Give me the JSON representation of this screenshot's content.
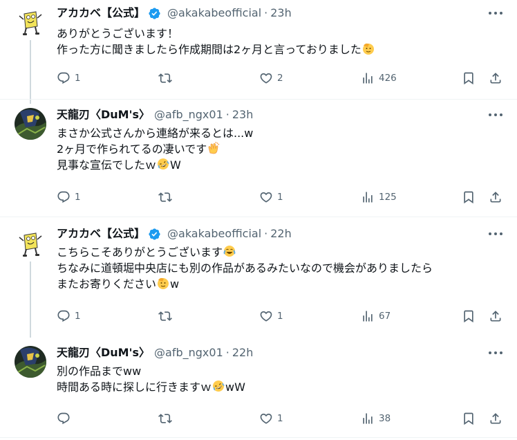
{
  "tweets": [
    {
      "name": "アカカベ【公式】",
      "verified": true,
      "handle": "@akakabeofficial",
      "time": "23h",
      "lines": [
        "ありがとうございます！",
        "作った方に聞きましたら作成期間は2ヶ月と言っておりました"
      ],
      "reply_count": "1",
      "retweet_count": "",
      "like_count": "2",
      "view_count": "426"
    },
    {
      "name": "天龍刃〈DuM's〉",
      "verified": false,
      "handle": "@afb_ngx01",
      "time": "23h",
      "lines": [
        "まさか公式さんから連絡が来るとは...w",
        "2ヶ月で作られてるの凄いです",
        "見事な宣伝でしたｗ",
        "W"
      ],
      "reply_count": "1",
      "retweet_count": "",
      "like_count": "1",
      "view_count": "125"
    },
    {
      "name": "アカカベ【公式】",
      "verified": true,
      "handle": "@akakabeofficial",
      "time": "22h",
      "lines": [
        "こちらこそありがとうございます",
        "ちなみに道頓堀中央店にも別の作品があるみたいなので機会がありましたら",
        "またお寄りください",
        "w"
      ],
      "reply_count": "1",
      "retweet_count": "",
      "like_count": "1",
      "view_count": "67"
    },
    {
      "name": "天龍刃〈DuM's〉",
      "verified": false,
      "handle": "@afb_ngx01",
      "time": "22h",
      "lines": [
        "別の作品までww",
        "時間ある時に探しに行きますｗ",
        "wW"
      ],
      "reply_count": "",
      "retweet_count": "",
      "like_count": "1",
      "view_count": "38"
    }
  ],
  "separator": "·",
  "icons": [
    "reply-icon",
    "retweet-icon",
    "like-icon",
    "views-icon",
    "bookmark-icon",
    "share-icon",
    "more-icon",
    "verified-badge-icon"
  ],
  "colors": {
    "verified": "#1d9bf0",
    "secondary_text": "#536471",
    "thread_line": "#cfd9de"
  }
}
